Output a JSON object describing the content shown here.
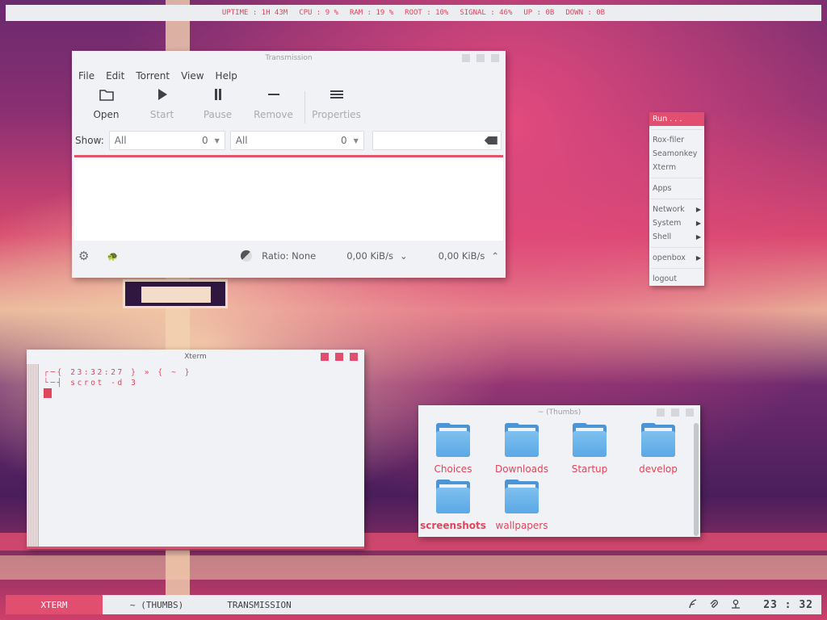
{
  "statusbar": {
    "items": [
      "UPTIME : 1H 43M",
      "CPU : 9 %",
      "RAM : 19 %",
      "ROOT : 10%",
      "SIGNAL : 46%",
      "UP : 0B",
      "DOWN : 0B"
    ]
  },
  "transmission": {
    "title": "Transmission",
    "menu": [
      "File",
      "Edit",
      "Torrent",
      "View",
      "Help"
    ],
    "toolbar": {
      "open": "Open",
      "start": "Start",
      "pause": "Pause",
      "remove": "Remove",
      "properties": "Properties"
    },
    "filter": {
      "show_label": "Show:",
      "combo1_value": "All",
      "combo1_count": "0",
      "combo2_value": "All",
      "combo2_count": "0"
    },
    "status": {
      "ratio": "Ratio: None",
      "down_speed": "0,00 KiB/s",
      "up_speed": "0,00 KiB/s"
    }
  },
  "xterm": {
    "title": "Xterm",
    "line1": "┌─{ 23:32:27 } » { ~ }",
    "line2": "└─┤ scrot -d 3"
  },
  "thumbs": {
    "title": "~ (Thumbs)",
    "folders": [
      "Choices",
      "Downloads",
      "Startup",
      "develop",
      "screenshots",
      "wallpapers"
    ]
  },
  "rootmenu": {
    "run": "Run . . .",
    "roxfiler": "Rox-filer",
    "seamonkey": "Seamonkey",
    "xterm": "Xterm",
    "apps": "Apps",
    "network": "Network",
    "system": "System",
    "shell": "Shell",
    "openbox": "openbox",
    "logout": "logout"
  },
  "panel": {
    "tasks": [
      "XTERM",
      "~ (THUMBS)",
      "TRANSMISSION"
    ],
    "clock": "23 : 32"
  },
  "colors": {
    "accent": "#e24e6f",
    "text_accent": "#e1455c",
    "window_bg": "#f1f2f5",
    "folder_blue": "#5aa8e6"
  },
  "icons": {
    "open": "folder-open-icon",
    "start": "play-icon",
    "pause": "pause-icon",
    "remove": "minus-icon",
    "properties": "menu-lines-icon",
    "clear": "backspace-clear-icon",
    "gear": "gear-icon",
    "turtle": "turtle-icon",
    "ratio": "ratio-yinyang-icon",
    "tray": [
      "feather-icon",
      "paperclip-icon",
      "user-icon"
    ]
  }
}
